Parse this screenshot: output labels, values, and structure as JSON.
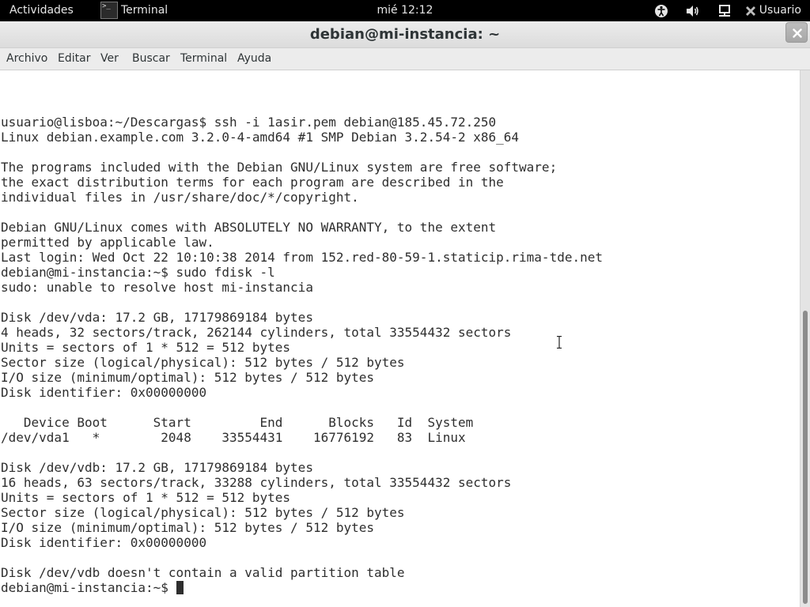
{
  "topbar": {
    "activities": "Actividades",
    "app_name": "Terminal",
    "clock": "mié 12:12",
    "user": "Usuario",
    "icons": [
      "accessibility-icon",
      "volume-icon",
      "network-icon",
      "user-icon"
    ]
  },
  "window": {
    "title": "debian@mi-instancia: ~"
  },
  "menubar": {
    "items": [
      "Archivo",
      "Editar",
      "Ver",
      "Buscar",
      "Terminal",
      "Ayuda"
    ]
  },
  "terminal": {
    "lines": [
      "usuario@lisboa:~/Descargas$ ssh -i 1asir.pem debian@185.45.72.250",
      "Linux debian.example.com 3.2.0-4-amd64 #1 SMP Debian 3.2.54-2 x86_64",
      "",
      "The programs included with the Debian GNU/Linux system are free software;",
      "the exact distribution terms for each program are described in the",
      "individual files in /usr/share/doc/*/copyright.",
      "",
      "Debian GNU/Linux comes with ABSOLUTELY NO WARRANTY, to the extent",
      "permitted by applicable law.",
      "Last login: Wed Oct 22 10:10:38 2014 from 152.red-80-59-1.staticip.rima-tde.net",
      "debian@mi-instancia:~$ sudo fdisk -l",
      "sudo: unable to resolve host mi-instancia",
      "",
      "Disk /dev/vda: 17.2 GB, 17179869184 bytes",
      "4 heads, 32 sectors/track, 262144 cylinders, total 33554432 sectors",
      "Units = sectors of 1 * 512 = 512 bytes",
      "Sector size (logical/physical): 512 bytes / 512 bytes",
      "I/O size (minimum/optimal): 512 bytes / 512 bytes",
      "Disk identifier: 0x00000000",
      "",
      "   Device Boot      Start         End      Blocks   Id  System",
      "/dev/vda1   *        2048    33554431    16776192   83  Linux",
      "",
      "Disk /dev/vdb: 17.2 GB, 17179869184 bytes",
      "16 heads, 63 sectors/track, 33288 cylinders, total 33554432 sectors",
      "Units = sectors of 1 * 512 = 512 bytes",
      "Sector size (logical/physical): 512 bytes / 512 bytes",
      "I/O size (minimum/optimal): 512 bytes / 512 bytes",
      "Disk identifier: 0x00000000",
      "",
      "Disk /dev/vdb doesn't contain a valid partition table"
    ],
    "prompt": "debian@mi-instancia:~$ "
  }
}
